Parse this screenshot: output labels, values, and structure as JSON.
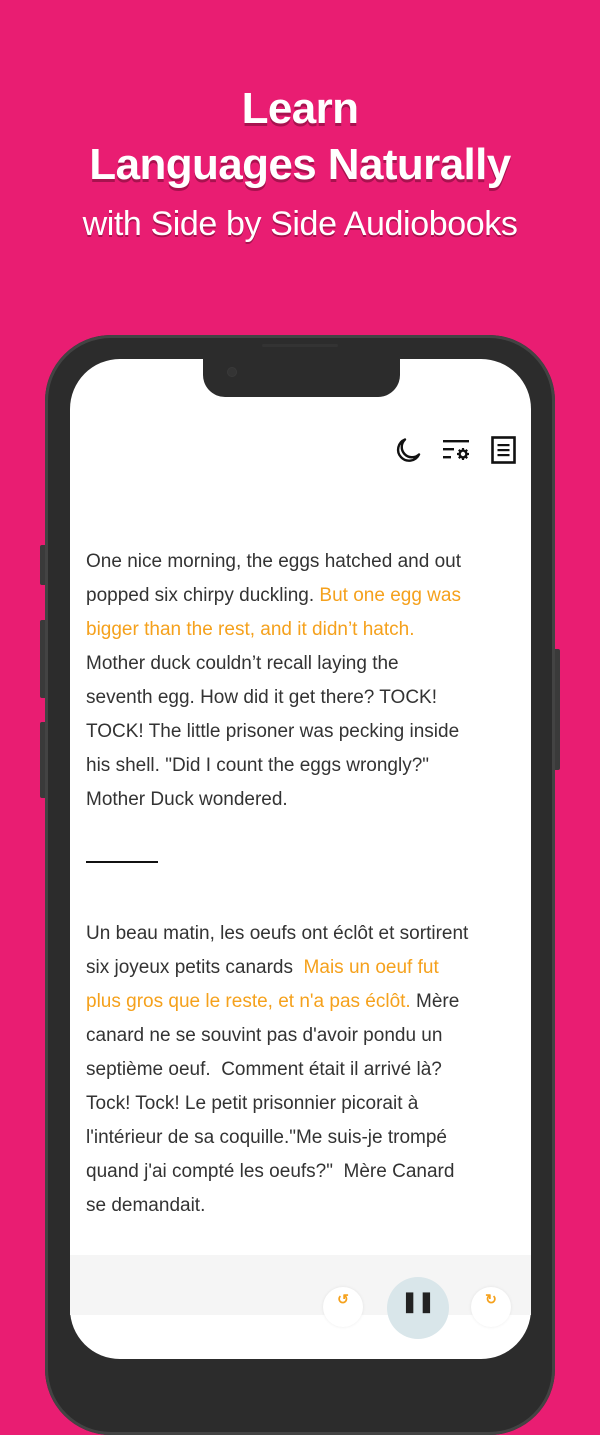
{
  "hero": {
    "title_line1": "Learn",
    "title_line2": "Languages Naturally",
    "subtitle": "with Side by Side Audiobooks"
  },
  "colors": {
    "background": "#E91D72",
    "highlight": "#F5A11C",
    "text": "#333333"
  },
  "toolbar": {
    "icons": [
      {
        "name": "moon-icon",
        "label": "Dark mode"
      },
      {
        "name": "text-settings-icon",
        "label": "Text settings"
      },
      {
        "name": "document-icon",
        "label": "Table of contents"
      }
    ]
  },
  "reader": {
    "english": {
      "lines": [
        [
          {
            "text": "One nice morning, the eggs hatched and out",
            "hl": false
          }
        ],
        [
          {
            "text": "popped six chirpy duckling. ",
            "hl": false
          },
          {
            "text": "But one egg was",
            "hl": true
          }
        ],
        [
          {
            "text": "bigger than the rest, and it didn’t hatch.",
            "hl": true
          }
        ],
        [
          {
            "text": "Mother duck couldn’t recall laying the",
            "hl": false
          }
        ],
        [
          {
            "text": "seventh egg. How did it get there? TOCK!",
            "hl": false
          }
        ],
        [
          {
            "text": "TOCK! The little prisoner was pecking inside",
            "hl": false
          }
        ],
        [
          {
            "text": "his shell. \"Did I count the eggs wrongly?\"",
            "hl": false
          }
        ],
        [
          {
            "text": "Mother Duck wondered.",
            "hl": false
          }
        ]
      ]
    },
    "french": {
      "lines": [
        [
          {
            "text": "Un beau matin, les oeufs ont éclôt et sortirent",
            "hl": false
          }
        ],
        [
          {
            "text": "six joyeux petits canards  ",
            "hl": false
          },
          {
            "text": "Mais un oeuf fut",
            "hl": true
          }
        ],
        [
          {
            "text": "plus gros que le reste, et n'a pas éclôt.",
            "hl": true
          },
          {
            "text": " Mère",
            "hl": false
          }
        ],
        [
          {
            "text": "canard ne se souvint pas d'avoir pondu un",
            "hl": false
          }
        ],
        [
          {
            "text": "septième oeuf.  Comment était il arrivé là?",
            "hl": false
          }
        ],
        [
          {
            "text": "Tock! Tock! Le petit prisonnier picorait à",
            "hl": false
          }
        ],
        [
          {
            "text": "l'intérieur de sa coquille.\"Me suis-je trompé",
            "hl": false
          }
        ],
        [
          {
            "text": "quand j'ai compté les oeufs?\"  Mère Canard",
            "hl": false
          }
        ],
        [
          {
            "text": "se demandait.",
            "hl": false
          }
        ]
      ]
    }
  },
  "player": {
    "rewind_glyph": "↺",
    "play_pause_glyph": "❚❚",
    "forward_glyph": "↻"
  }
}
